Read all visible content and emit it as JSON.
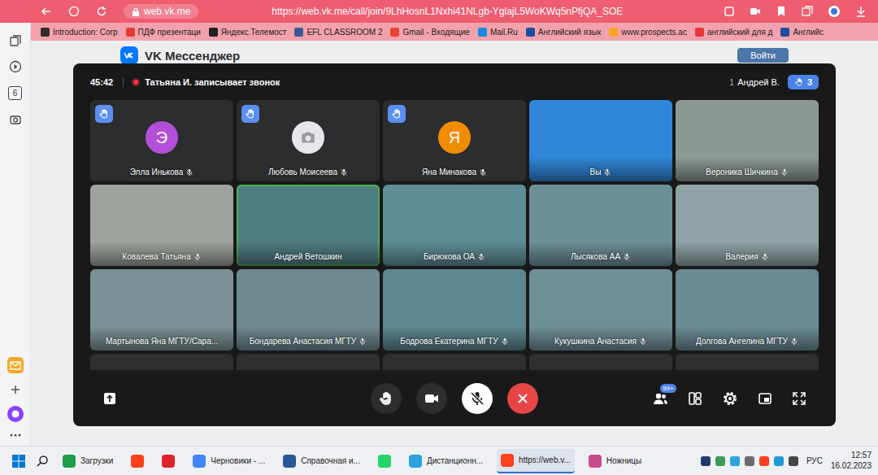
{
  "browser": {
    "site": "web.vk.me",
    "url": "https://web.vk.me/call/join/9LhHosnL1Nxhi41NLgb-YglajL5WoKWq5nPfjQA_SOE"
  },
  "bookmarks": [
    {
      "label": "Introduction: Corp",
      "color": "#2d2d2d"
    },
    {
      "label": "ПДФ презентаци",
      "color": "#e53935"
    },
    {
      "label": "Яндекс.Телемост",
      "color": "#222222"
    },
    {
      "label": "EFL CLASSROOM 2",
      "color": "#3b5998"
    },
    {
      "label": "Gmail - Входящие",
      "color": "#ea4335"
    },
    {
      "label": "Mail.Ru",
      "color": "#168de2"
    },
    {
      "label": "Английский язык",
      "color": "#1a4fa0"
    },
    {
      "label": "www.prospects.ac",
      "color": "#f5a623"
    },
    {
      "label": "английский для д",
      "color": "#e53935"
    },
    {
      "label": "Английс",
      "color": "#1a4fa0"
    }
  ],
  "sidebar": {
    "badge": "6"
  },
  "page": {
    "title": "VK Мессенджер",
    "login_button": "Войти"
  },
  "call": {
    "timer": "45:42",
    "recording": "Татьяна И. записывает звонок",
    "speaker_count": "1",
    "speaker": "Андрей В.",
    "raised_hands": "3",
    "tiles": [
      {
        "kind": "avatar",
        "name": "Элла Инькова",
        "letter": "Э",
        "color": "#b44fd9",
        "muted": true,
        "hand_raised": true,
        "speaking": false
      },
      {
        "kind": "placeholder",
        "name": "Любовь Моисеева",
        "color": "#e6e7ea",
        "muted": true,
        "hand_raised": true,
        "speaking": false
      },
      {
        "kind": "avatar",
        "name": "Яна Минакова",
        "letter": "Я",
        "color": "#f08c00",
        "muted": true,
        "hand_raised": true,
        "speaking": false
      },
      {
        "kind": "video",
        "name": "Вы",
        "color": "#2f86d8",
        "muted": true,
        "hand_raised": false,
        "speaking": false
      },
      {
        "kind": "video",
        "name": "Вероника Шичкина",
        "color": "#8c9a96",
        "muted": true,
        "hand_raised": false,
        "speaking": false
      },
      {
        "kind": "video",
        "name": "Ковалева Татьяна",
        "color": "#9ea39d",
        "muted": true,
        "hand_raised": false,
        "speaking": false
      },
      {
        "kind": "video",
        "name": "Андрей Ветошкин",
        "color": "#4f7d82",
        "muted": false,
        "hand_raised": false,
        "speaking": true
      },
      {
        "kind": "video",
        "name": "Бирюкова ОА",
        "color": "#5f8d96",
        "muted": true,
        "hand_raised": false,
        "speaking": false
      },
      {
        "kind": "video",
        "name": "Лысякова АА",
        "color": "#6c8f97",
        "muted": true,
        "hand_raised": false,
        "speaking": false
      },
      {
        "kind": "video",
        "name": "Валерия",
        "color": "#8fa3a6",
        "muted": true,
        "hand_raised": false,
        "speaking": false
      },
      {
        "kind": "video",
        "name": "Мартынова Яна МГТУ/Сара...",
        "color": "#7b9296",
        "muted": false,
        "hand_raised": false,
        "speaking": false
      },
      {
        "kind": "video",
        "name": "Бондарева Анастасия МГТУ",
        "color": "#6e8a90",
        "muted": true,
        "hand_raised": false,
        "speaking": false
      },
      {
        "kind": "video",
        "name": "Бодрова Екатерина МГТУ",
        "color": "#5d8790",
        "muted": true,
        "hand_raised": false,
        "speaking": false
      },
      {
        "kind": "video",
        "name": "Кукушкина Анастасия",
        "color": "#6f8f96",
        "muted": true,
        "hand_raised": false,
        "speaking": false
      },
      {
        "kind": "video",
        "name": "Долгова Ангелина МГТУ",
        "color": "#6b8c94",
        "muted": true,
        "hand_raised": false,
        "speaking": false
      },
      {
        "kind": "cut",
        "color": "#2e2f31"
      },
      {
        "kind": "cut",
        "color": "#2e2f31"
      },
      {
        "kind": "cut",
        "color": "#2e2f31"
      },
      {
        "kind": "cut",
        "color": "#2e2f31"
      },
      {
        "kind": "cut",
        "color": "#2e2f31"
      }
    ],
    "controls": {
      "mic_muted": true,
      "camera_on": true,
      "participants_badge": "99+"
    }
  },
  "taskbar": {
    "apps": [
      {
        "kind": "labeled",
        "label": "Загрузки",
        "color": "#1e9c4a",
        "selected": false
      },
      {
        "kind": "icon",
        "color": "#fc3f1d",
        "selected": false
      },
      {
        "kind": "icon",
        "color": "#e0202b",
        "selected": false
      },
      {
        "kind": "labeled",
        "label": "Черновики - ...",
        "color": "#4285f4",
        "selected": false
      },
      {
        "kind": "labeled",
        "label": "Справочная и...",
        "color": "#2b5797",
        "selected": false
      },
      {
        "kind": "icon",
        "color": "#25d366",
        "selected": false
      },
      {
        "kind": "labeled",
        "label": "Дистанционн...",
        "color": "#2aa3de",
        "selected": false
      },
      {
        "kind": "labeled",
        "label": "https://web.v...",
        "color": "#fc3f1d",
        "selected": true
      },
      {
        "kind": "labeled",
        "label": "Ножницы",
        "color": "#c84b8f",
        "selected": false
      }
    ],
    "tray": {
      "language": "РУС",
      "time": "12:57",
      "date": "16.02.2023"
    }
  }
}
